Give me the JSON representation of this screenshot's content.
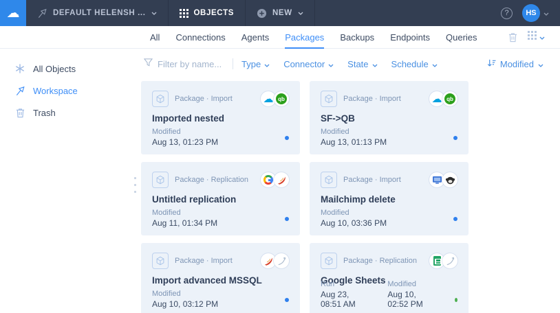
{
  "accent_color": "#3e8ef7",
  "topbar": {
    "workspace_label": "DEFAULT HELENSH ...",
    "objects_label": "OBJECTS",
    "new_label": "NEW",
    "help_label": "?",
    "avatar_initials": "HS"
  },
  "tabs": [
    {
      "label": "All",
      "active": false
    },
    {
      "label": "Connections",
      "active": false
    },
    {
      "label": "Agents",
      "active": false
    },
    {
      "label": "Packages",
      "active": true
    },
    {
      "label": "Backups",
      "active": false
    },
    {
      "label": "Endpoints",
      "active": false
    },
    {
      "label": "Queries",
      "active": false
    }
  ],
  "sidebar": {
    "items": [
      {
        "label": "All Objects",
        "icon": "asterisk-icon",
        "active": false
      },
      {
        "label": "Workspace",
        "icon": "flag-icon",
        "active": true
      },
      {
        "label": "Trash",
        "icon": "trash-icon",
        "active": false
      }
    ]
  },
  "filters": {
    "search_placeholder": "Filter by name...",
    "dropdowns": [
      {
        "label": "Type"
      },
      {
        "label": "Connector"
      },
      {
        "label": "State"
      },
      {
        "label": "Schedule"
      }
    ],
    "sort_label": "Modified"
  },
  "cards": [
    {
      "type_label": "Package · Import",
      "title": "Imported nested",
      "connectors": [
        "salesforce-icon",
        "quickbooks-icon"
      ],
      "meta": [
        {
          "label": "Modified",
          "value": "Aug 13, 01:23 PM"
        }
      ],
      "status_color": "#2f80ed"
    },
    {
      "type_label": "Package · Import",
      "title": "SF->QB",
      "connectors": [
        "salesforce-icon",
        "quickbooks-icon"
      ],
      "meta": [
        {
          "label": "Modified",
          "value": "Aug 13, 01:13 PM"
        }
      ],
      "status_color": "#2f80ed"
    },
    {
      "type_label": "Package · Replication",
      "title": "Untitled replication",
      "connectors": [
        "google-icon",
        "sqlserver-icon"
      ],
      "meta": [
        {
          "label": "Modified",
          "value": "Aug 11, 01:34 PM"
        }
      ],
      "status_color": "#2f80ed"
    },
    {
      "type_label": "Package · Import",
      "title": "Mailchimp delete",
      "connectors": [
        "csv-monitor-icon",
        "mailchimp-icon"
      ],
      "meta": [
        {
          "label": "Modified",
          "value": "Aug 10, 03:36 PM"
        }
      ],
      "status_color": "#2f80ed"
    },
    {
      "type_label": "Package · Import",
      "title": "Import advanced MSSQL",
      "connectors": [
        "sqlserver-icon",
        "database-icon"
      ],
      "meta": [
        {
          "label": "Modified",
          "value": "Aug 10, 03:12 PM"
        }
      ],
      "status_color": "#2f80ed"
    },
    {
      "type_label": "Package · Replication",
      "title": "Google Sheets",
      "connectors": [
        "google-sheets-icon",
        "database-icon"
      ],
      "meta": [
        {
          "label": "Run",
          "value": "Aug 23, 08:51 AM"
        },
        {
          "label": "Modified",
          "value": "Aug 10, 02:52 PM"
        }
      ],
      "status_color": "#4caf50"
    }
  ]
}
